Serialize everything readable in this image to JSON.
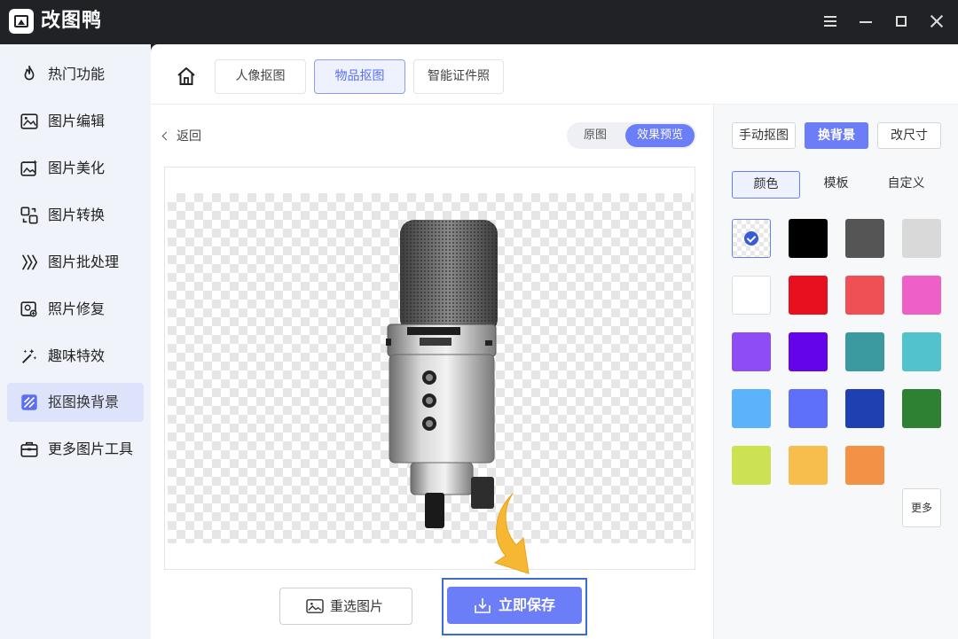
{
  "app": {
    "title": "改图鸭"
  },
  "sidebar": {
    "items": [
      {
        "label": "热门功能",
        "icon": "fire-icon"
      },
      {
        "label": "图片编辑",
        "icon": "image-edit-icon"
      },
      {
        "label": "图片美化",
        "icon": "image-beautify-icon"
      },
      {
        "label": "图片转换",
        "icon": "image-convert-icon"
      },
      {
        "label": "图片批处理",
        "icon": "batch-process-icon"
      },
      {
        "label": "照片修复",
        "icon": "photo-repair-icon"
      },
      {
        "label": "趣味特效",
        "icon": "magic-wand-icon"
      },
      {
        "label": "抠图换背景",
        "icon": "cutout-icon",
        "active": true
      },
      {
        "label": "更多图片工具",
        "icon": "toolbox-icon"
      }
    ]
  },
  "topbar": {
    "tabs": [
      {
        "label": "人像抠图"
      },
      {
        "label": "物品抠图",
        "active": true
      },
      {
        "label": "智能证件照"
      }
    ]
  },
  "editor": {
    "back_label": "返回",
    "toggle": {
      "original": "原图",
      "preview": "效果预览",
      "selected": "preview"
    },
    "reselect_label": "重选图片",
    "save_label": "立即保存"
  },
  "rightpanel": {
    "modes": [
      {
        "label": "手动抠图"
      },
      {
        "label": "换背景",
        "active": true
      },
      {
        "label": "改尺寸"
      }
    ],
    "subtabs": [
      {
        "label": "颜色",
        "active": true
      },
      {
        "label": "模板"
      },
      {
        "label": "自定义"
      }
    ],
    "colors": [
      "transparent",
      "#000000",
      "#555555",
      "#d9d9d9",
      "#ffffff",
      "#e8101e",
      "#ee5056",
      "#ee5fc8",
      "#8e4cf6",
      "#6404ea",
      "#3b9aa0",
      "#52c2cc",
      "#5cb3fb",
      "#5e6ff9",
      "#1e40b0",
      "#2e8032",
      "#cde253",
      "#f7bd4d",
      "#f39146"
    ],
    "selected_color": "transparent",
    "more_label": "更多"
  }
}
